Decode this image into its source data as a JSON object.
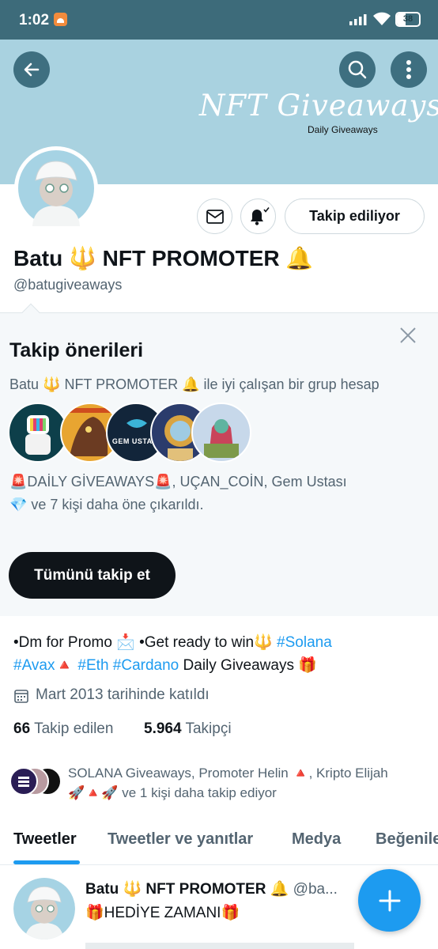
{
  "status_bar": {
    "time": "1:02",
    "battery": "38"
  },
  "banner": {
    "script_title": "NFT Giveaways",
    "subtitle": "Daily Giveaways",
    "color": "#a9d2e0"
  },
  "profile": {
    "name": "Batu 🔱 NFT PROMOTER 🔔",
    "handle": "@batugiveaways",
    "follow_button": "Takip ediliyor",
    "bio_line1_plain": "•Dm for Promo 📩 •Get ready to win🔱 ",
    "bio_tag_solana": "#Solana",
    "bio_tag_avax": "#Avax",
    "bio_triangle": "🔺",
    "bio_tag_eth_cardano": "#Eth #Cardano",
    "bio_line2_tail": " Daily Giveaways 🎁",
    "joined": "Mart 2013 tarihinde katıldı",
    "following_count": "66",
    "following_label": "Takip edilen",
    "followers_count": "5.964",
    "followers_label": "Takipçi",
    "followed_by_line1": "SOLANA Giveaways, Promoter Helin 🔺, Kripto Elijah",
    "followed_by_line2": "🚀🔺🚀 ve 1 kişi daha takip ediyor"
  },
  "suggestions": {
    "title": "Takip önerileri",
    "subtitle": "Batu 🔱 NFT PROMOTER 🔔 ile iyi çalışan bir grup hesap",
    "accounts_line1": "🚨DAİLY GİVEAWAYS🚨, UÇAN_COİN, Gem Ustası",
    "accounts_line2": "💎 ve 7 kişi daha öne çıkarıldı.",
    "gem_avatar_label": "GEM USTASI",
    "follow_all_button": "Tümünü takip et"
  },
  "tabs": [
    "Tweetler",
    "Tweetler ve yanıtlar",
    "Medya",
    "Beğeniler"
  ],
  "tweet": {
    "author": "Batu 🔱 NFT PROMOTER 🔔",
    "handle": "@ba...",
    "text": "🎁HEDİYE ZAMANI🎁"
  },
  "colors": {
    "accent": "#1d9bf0",
    "status_bar": "#3d6b7a",
    "dark_button": "#0f1419"
  }
}
